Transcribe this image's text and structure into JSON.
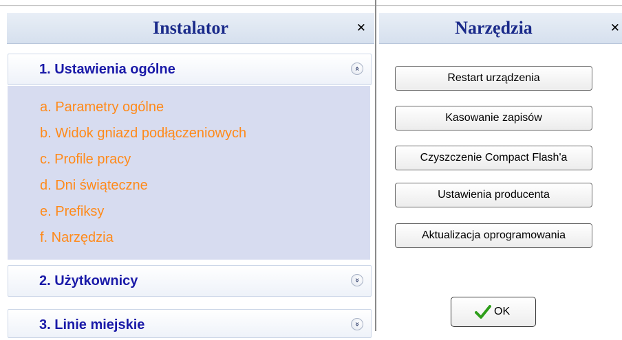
{
  "installer": {
    "title": "Instalator",
    "close": "✕",
    "sections": [
      {
        "title": "1. Ustawienia ogólne",
        "chevron": "«",
        "expanded": true,
        "items": [
          "a. Parametry ogólne",
          "b. Widok gniazd podłączeniowych",
          "c. Profile pracy",
          "d. Dni świąteczne",
          "e. Prefiksy",
          "f. Narzędzia"
        ]
      },
      {
        "title": "2. Użytkownicy",
        "chevron": "»",
        "expanded": false
      },
      {
        "title": "3. Linie miejskie",
        "chevron": "»",
        "expanded": false
      }
    ]
  },
  "tools": {
    "title": "Narzędzia",
    "close": "✕",
    "buttons": [
      "Restart urządzenia",
      "Kasowanie zapisów",
      "Czyszczenie Compact Flash'a",
      "Ustawienia producenta",
      "Aktualizacja oprogramowania"
    ],
    "ok_label": "OK",
    "ok_icon": "checkmark-icon",
    "ok_icon_color": "#2e9e1a"
  },
  "colors": {
    "title_text": "#1a2a8a",
    "section_title": "#1a1aa8",
    "link": "#ff8a1a",
    "section_body": "#d7dcf0"
  }
}
